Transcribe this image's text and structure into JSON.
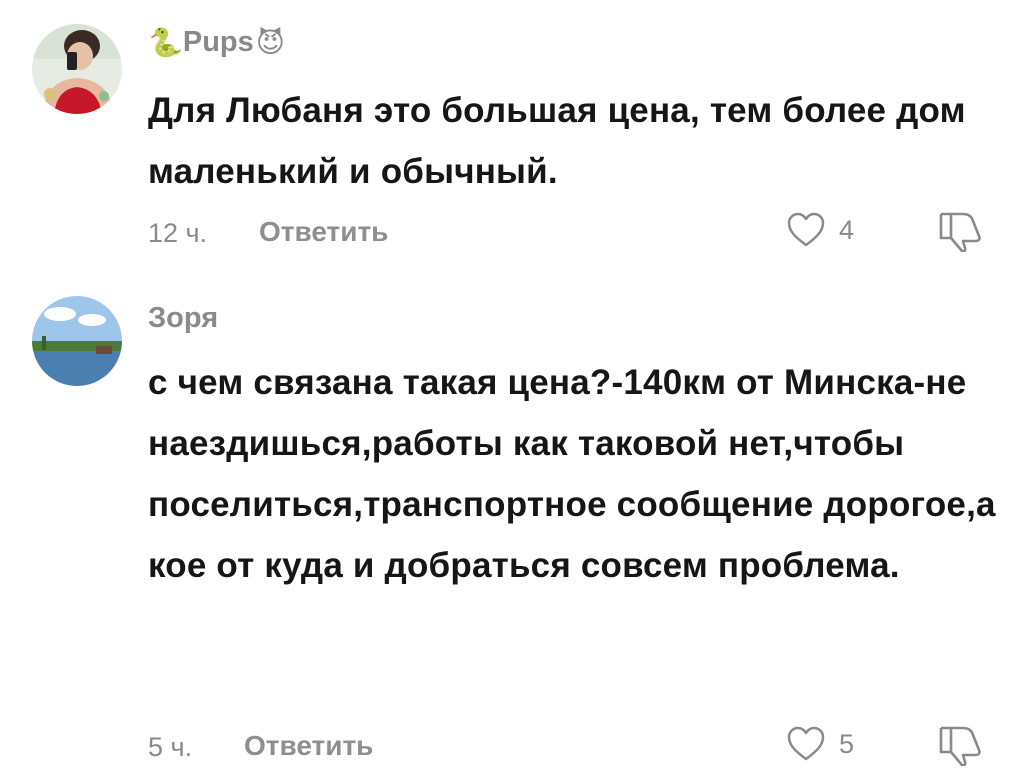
{
  "comments": [
    {
      "username": "Pups",
      "username_prefix_icon": "snake-emoji",
      "username_suffix_icon": "smiling-devil-emoji",
      "text": "Для Любаня это большая цена, тем более дом маленький и обычный.",
      "time": "12 ч.",
      "reply_label": "Ответить",
      "likes": "4",
      "like_icon": "heart-outline-icon",
      "dislike_icon": "thumbs-down-outline-icon"
    },
    {
      "username": "Зоря",
      "text": "с чем связана такая цена?-140км от Минска-не наездишься,работы как таковой нет,чтобы поселиться,транспортное сообщение дорогое,а кое от куда и добраться совсем проблема.",
      "time": "5 ч.",
      "reply_label": "Ответить",
      "likes": "5",
      "like_icon": "heart-outline-icon",
      "dislike_icon": "thumbs-down-outline-icon"
    }
  ],
  "colors": {
    "text": "#161616",
    "muted": "#8a8a8a",
    "background": "#ffffff"
  }
}
